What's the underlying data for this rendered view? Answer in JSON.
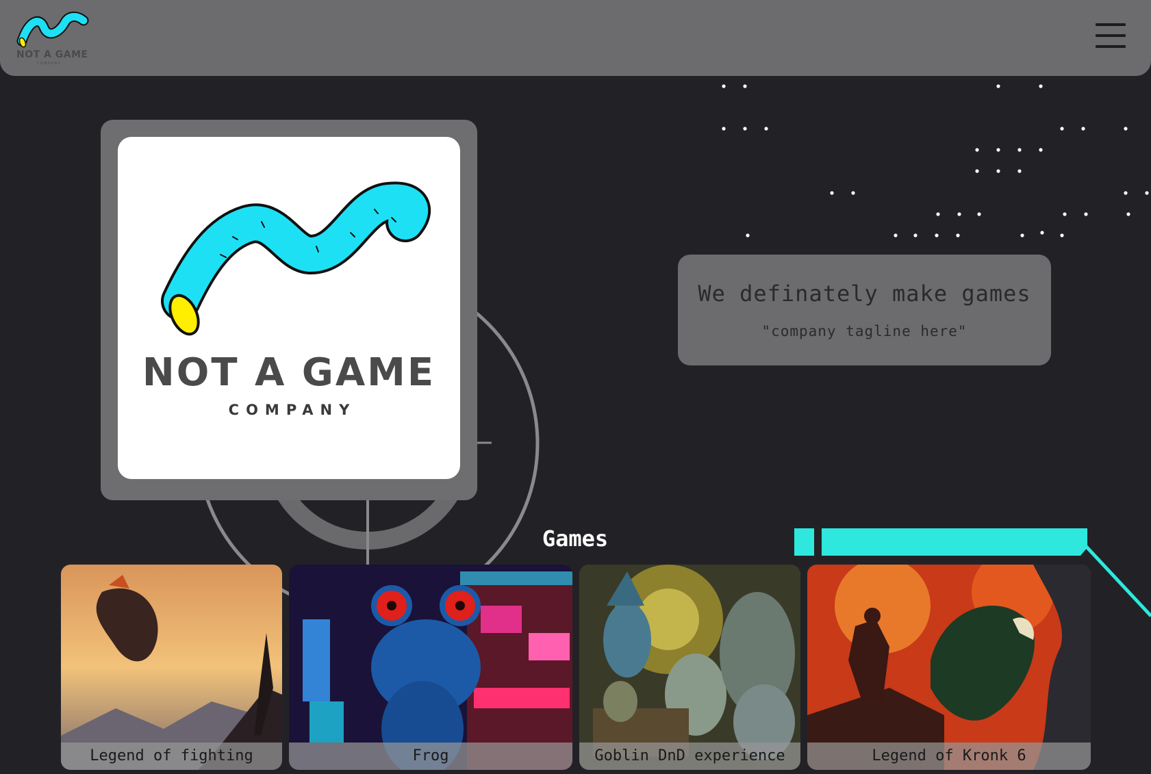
{
  "header": {
    "logo_text": "NOT A GAME",
    "logo_subtext": "COMPANY",
    "menu_icon": "hamburger-menu-icon"
  },
  "hero": {
    "brand_name": "NOT A GAME",
    "brand_sub": "COMPANY"
  },
  "tagline": {
    "title": "We definately make games",
    "subtitle": "\"company tagline here\""
  },
  "games": {
    "title": "Games",
    "items": [
      {
        "name": "Legend of fighting"
      },
      {
        "name": "Frog"
      },
      {
        "name": "Goblin DnD experience"
      },
      {
        "name": "Legend of Kronk 6"
      }
    ]
  },
  "colors": {
    "background": "#222226",
    "header": "#6c6c6e",
    "card": "#6e6e70",
    "accent_cyan": "#2ee8dd",
    "logo_cyan": "#1ee0f5",
    "logo_yellow": "#ffee00"
  }
}
